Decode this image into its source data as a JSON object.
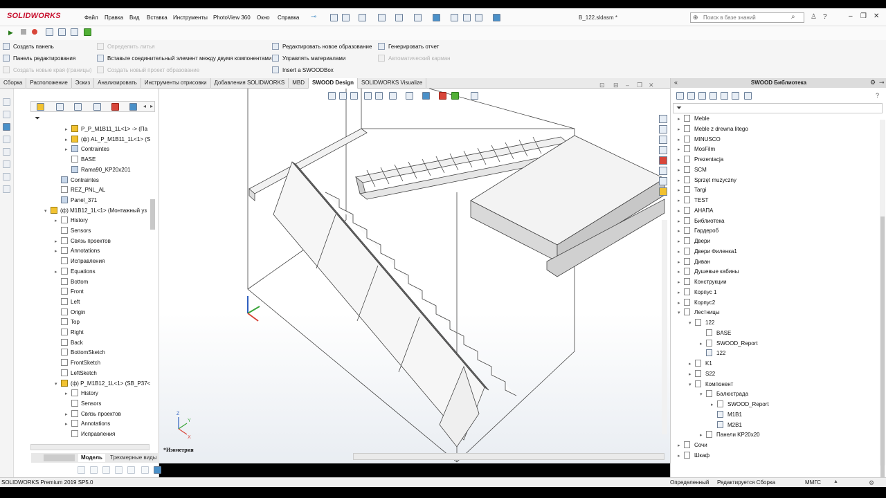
{
  "app": {
    "logo": "SOLIDWORKS",
    "document_title": "B_122.sldasm *",
    "menu": [
      "Файл",
      "Правка",
      "Вид",
      "Вставка",
      "Инструменты",
      "PhotoView 360",
      "Окно",
      "Справка"
    ],
    "search_placeholder": "Поиск в базе знаний"
  },
  "commands": {
    "col1": [
      "Создать панель",
      "Панель редактирования",
      "Создать новые края (границы)"
    ],
    "col2": [
      "Определить литья",
      "Вставьте соединительный элемент между двумя компонентами",
      "Создать новый проект образование"
    ],
    "col3": [
      "Редактировать новое образование",
      "Управлять материалами",
      "Insert a SWOODBox"
    ],
    "col4": [
      "Генерировать отчет",
      "Автоматический карман"
    ]
  },
  "tabs": [
    "Сборка",
    "Расположение",
    "Эскиз",
    "Анализировать",
    "Инструменты отрисовки",
    "Добавления SOLIDWORKS",
    "MBD",
    "SWOOD Design",
    "SOLIDWORKS Visualize"
  ],
  "active_tab": "SWOOD Design",
  "tree": [
    {
      "label": "P_P_M1B11_1L<1> -> (Па",
      "indent": 4,
      "arrow": "▸",
      "icon": "asm"
    },
    {
      "label": "(ф) AL_P_M1B11_1L<1> (S",
      "indent": 4,
      "arrow": "▸",
      "icon": "asm"
    },
    {
      "label": "Contraintes",
      "indent": 4,
      "arrow": "▸",
      "icon": "part"
    },
    {
      "label": "BASE",
      "indent": 4,
      "arrow": "",
      "icon": "folder"
    },
    {
      "label": "Rama90_KP20x201",
      "indent": 4,
      "arrow": "",
      "icon": "part"
    },
    {
      "label": "Contraintes",
      "indent": 3,
      "arrow": "",
      "icon": "part"
    },
    {
      "label": "REZ_PNL_AL",
      "indent": 3,
      "arrow": "",
      "icon": "folder"
    },
    {
      "label": "Panel_371",
      "indent": 3,
      "arrow": "",
      "icon": "part"
    },
    {
      "label": "(ф) M1B12_1L<1> (Монтажный уз",
      "indent": 2,
      "arrow": "▾",
      "icon": "asm"
    },
    {
      "label": "History",
      "indent": 3,
      "arrow": "▸",
      "icon": "folder"
    },
    {
      "label": "Sensors",
      "indent": 3,
      "arrow": "",
      "icon": "folder"
    },
    {
      "label": "Связь проектов",
      "indent": 3,
      "arrow": "▸",
      "icon": "folder"
    },
    {
      "label": "Annotations",
      "indent": 3,
      "arrow": "▸",
      "icon": "folder"
    },
    {
      "label": "Исправления",
      "indent": 3,
      "arrow": "",
      "icon": "folder"
    },
    {
      "label": "Equations",
      "indent": 3,
      "arrow": "▸",
      "icon": "folder"
    },
    {
      "label": "Bottom",
      "indent": 3,
      "arrow": "",
      "icon": "folder"
    },
    {
      "label": "Front",
      "indent": 3,
      "arrow": "",
      "icon": "folder"
    },
    {
      "label": "Left",
      "indent": 3,
      "arrow": "",
      "icon": "folder"
    },
    {
      "label": "Origin",
      "indent": 3,
      "arrow": "",
      "icon": "folder"
    },
    {
      "label": "Top",
      "indent": 3,
      "arrow": "",
      "icon": "folder"
    },
    {
      "label": "Right",
      "indent": 3,
      "arrow": "",
      "icon": "folder"
    },
    {
      "label": "Back",
      "indent": 3,
      "arrow": "",
      "icon": "folder"
    },
    {
      "label": "BottomSketch",
      "indent": 3,
      "arrow": "",
      "icon": "folder"
    },
    {
      "label": "FrontSketch",
      "indent": 3,
      "arrow": "",
      "icon": "folder"
    },
    {
      "label": "LeftSketch",
      "indent": 3,
      "arrow": "",
      "icon": "folder"
    },
    {
      "label": "(ф) P_M1B12_1L<1> (SB_P37<",
      "indent": 3,
      "arrow": "▾",
      "icon": "asm"
    },
    {
      "label": "History",
      "indent": 4,
      "arrow": "▸",
      "icon": "folder"
    },
    {
      "label": "Sensors",
      "indent": 4,
      "arrow": "",
      "icon": "folder"
    },
    {
      "label": "Связь проектов",
      "indent": 4,
      "arrow": "▸",
      "icon": "folder"
    },
    {
      "label": "Annotations",
      "indent": 4,
      "arrow": "▸",
      "icon": "folder"
    },
    {
      "label": "Исправления",
      "indent": 4,
      "arrow": "",
      "icon": "folder"
    }
  ],
  "bottom_tabs": [
    "Модель",
    "Трехмерные виды"
  ],
  "view_label": "*Изометрия",
  "library": {
    "title": "SWOOD Библиотека",
    "items": [
      {
        "label": "Meble",
        "indent": 0,
        "arrow": "▸",
        "icon": "folder"
      },
      {
        "label": "Meble z drewna litego",
        "indent": 0,
        "arrow": "▸",
        "icon": "folder"
      },
      {
        "label": "MINUSCO",
        "indent": 0,
        "arrow": "▸",
        "icon": "folder"
      },
      {
        "label": "MosFilm",
        "indent": 0,
        "arrow": "▸",
        "icon": "folder"
      },
      {
        "label": "Prezentacja",
        "indent": 0,
        "arrow": "▸",
        "icon": "folder"
      },
      {
        "label": "SCM",
        "indent": 0,
        "arrow": "▸",
        "icon": "folder"
      },
      {
        "label": "Sprzęt muzyczny",
        "indent": 0,
        "arrow": "▸",
        "icon": "folder"
      },
      {
        "label": "Targi",
        "indent": 0,
        "arrow": "▸",
        "icon": "folder"
      },
      {
        "label": "TEST",
        "indent": 0,
        "arrow": "▸",
        "icon": "folder"
      },
      {
        "label": "АНАПА",
        "indent": 0,
        "arrow": "▸",
        "icon": "folder"
      },
      {
        "label": "Библиотека",
        "indent": 0,
        "arrow": "▸",
        "icon": "folder"
      },
      {
        "label": "Гардероб",
        "indent": 0,
        "arrow": "▸",
        "icon": "folder"
      },
      {
        "label": "Двери",
        "indent": 0,
        "arrow": "▸",
        "icon": "folder"
      },
      {
        "label": "Двери Филенка1",
        "indent": 0,
        "arrow": "▸",
        "icon": "folder"
      },
      {
        "label": "Диван",
        "indent": 0,
        "arrow": "▸",
        "icon": "folder"
      },
      {
        "label": "Душевые кабины",
        "indent": 0,
        "arrow": "▸",
        "icon": "folder"
      },
      {
        "label": "Конструкции",
        "indent": 0,
        "arrow": "▸",
        "icon": "folder"
      },
      {
        "label": "Корпус 1",
        "indent": 0,
        "arrow": "▸",
        "icon": "folder"
      },
      {
        "label": "Корпус2",
        "indent": 0,
        "arrow": "▸",
        "icon": "folder"
      },
      {
        "label": "Лестницы",
        "indent": 0,
        "arrow": "▾",
        "icon": "folder"
      },
      {
        "label": "122",
        "indent": 1,
        "arrow": "▾",
        "icon": "folder"
      },
      {
        "label": "BASE",
        "indent": 2,
        "arrow": "",
        "icon": "folder"
      },
      {
        "label": "SWOOD_Report",
        "indent": 2,
        "arrow": "▸",
        "icon": "folder"
      },
      {
        "label": "122",
        "indent": 2,
        "arrow": "",
        "icon": "doc"
      },
      {
        "label": "K1",
        "indent": 1,
        "arrow": "▸",
        "icon": "folder"
      },
      {
        "label": "S22",
        "indent": 1,
        "arrow": "▸",
        "icon": "folder"
      },
      {
        "label": "Компонент",
        "indent": 1,
        "arrow": "▾",
        "icon": "folder"
      },
      {
        "label": "Балюстрада",
        "indent": 2,
        "arrow": "▾",
        "icon": "folder"
      },
      {
        "label": "SWOOD_Report",
        "indent": 3,
        "arrow": "▸",
        "icon": "folder"
      },
      {
        "label": "M1B1",
        "indent": 3,
        "arrow": "",
        "icon": "doc"
      },
      {
        "label": "M2B1",
        "indent": 3,
        "arrow": "",
        "icon": "doc"
      },
      {
        "label": "Панели KP20x20",
        "indent": 2,
        "arrow": "▸",
        "icon": "folder"
      },
      {
        "label": "Сочи",
        "indent": 0,
        "arrow": "▸",
        "icon": "folder"
      },
      {
        "label": "Шкаф",
        "indent": 0,
        "arrow": "▸",
        "icon": "folder"
      }
    ]
  },
  "status": {
    "version": "SOLIDWORKS Premium 2019 SP5.0",
    "defined": "Определенный",
    "editing": "Редактируется Сборка",
    "units": "ММГС"
  },
  "colors": {
    "brand": "#c8102e",
    "accent": "#4a90c8"
  }
}
